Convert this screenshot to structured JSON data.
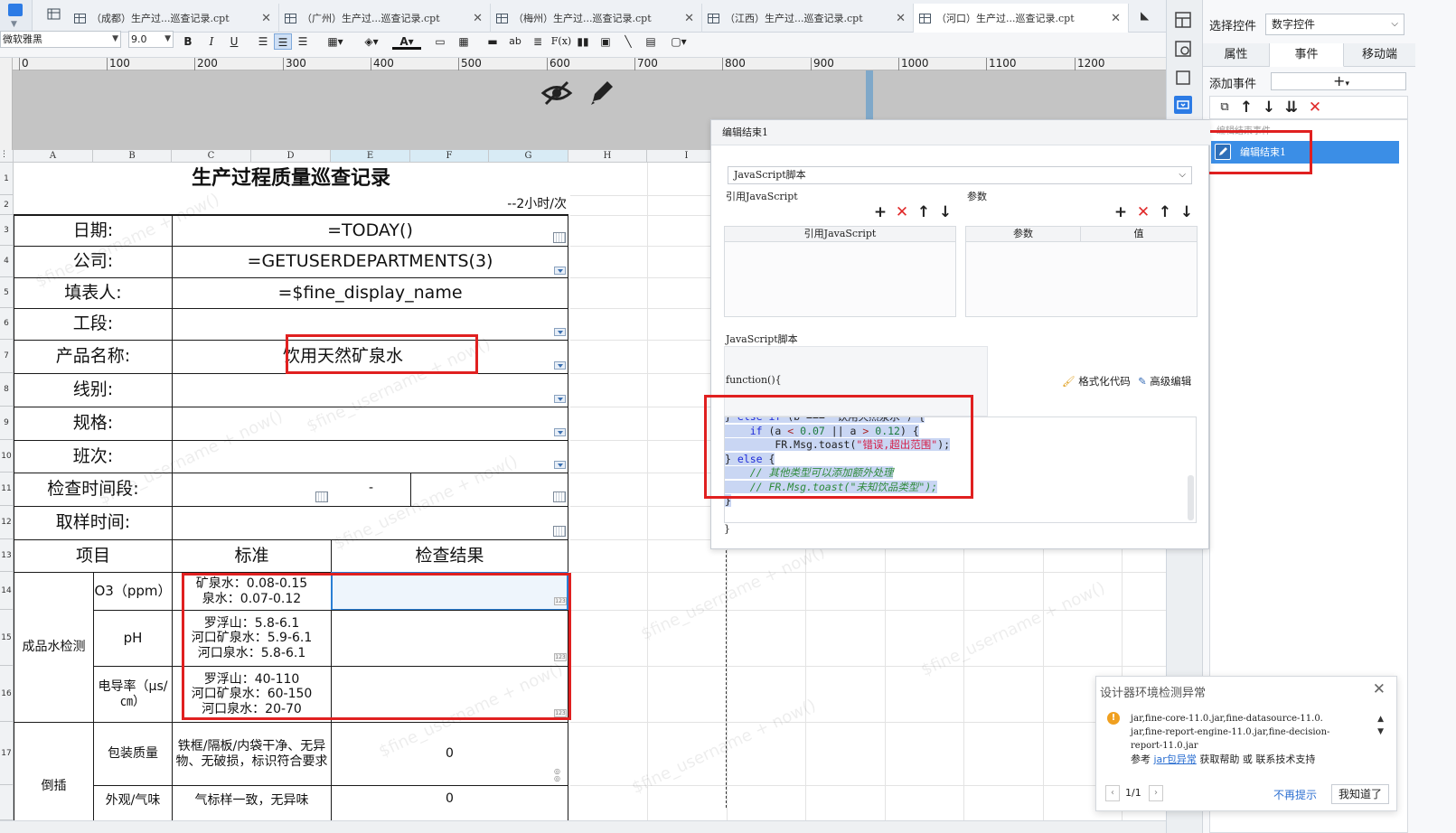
{
  "tabs": [
    {
      "label": "（成都）生产过...巡查记录.cpt",
      "active": false
    },
    {
      "label": "（广州）生产过...巡查记录.cpt",
      "active": false
    },
    {
      "label": "（梅州）生产过...巡查记录.cpt",
      "active": false
    },
    {
      "label": "（江西）生产过...巡查记录.cpt",
      "active": false
    },
    {
      "label": "（河口）生产过...巡查记录.cpt",
      "active": true
    }
  ],
  "toolbar": {
    "font_name": "微软雅黑",
    "font_size": "9.0",
    "bold": "B",
    "italic": "I",
    "underline": "U",
    "text_style_a": "A",
    "ab_label": "ab",
    "fx_label": "F(x)"
  },
  "ruler": {
    "marks": [
      "0",
      "100",
      "200",
      "300",
      "400",
      "500",
      "600",
      "700",
      "800",
      "900",
      "1000",
      "1100",
      "1200"
    ]
  },
  "columns": [
    "A",
    "B",
    "C",
    "D",
    "E",
    "F",
    "G",
    "H",
    "I"
  ],
  "rows": [
    "1",
    "2",
    "3",
    "4",
    "5",
    "6",
    "7",
    "8",
    "9",
    "10",
    "11",
    "12",
    "13",
    "14",
    "15",
    "16",
    "17"
  ],
  "report": {
    "title": "生产过程质量巡查记录",
    "frequency": "--2小时/次",
    "date_label": "日期:",
    "date_value": "=TODAY()",
    "company_label": "公司:",
    "company_value": "=GETUSERDEPARTMENTS(3)",
    "filler_label": "填表人:",
    "filler_value": "=$fine_display_name",
    "section_label": "工段:",
    "product_label": "产品名称:",
    "product_value": "饮用天然矿泉水",
    "line_label": "线别:",
    "spec_label": "规格:",
    "shift_label": "班次:",
    "period_label": "检查时间段:",
    "period_sep": "-",
    "sample_label": "取样时间:",
    "col_item": "项目",
    "col_standard": "标准",
    "col_result": "检查结果",
    "group1": "成品水检测",
    "o3_label": "O3（ppm）",
    "o3_std": [
      "矿泉水：0.08-0.15",
      "泉水：0.07-0.12"
    ],
    "ph_label": "pH",
    "ph_std": [
      "罗浮山：5.8-6.1",
      "河口矿泉水：5.9-6.1",
      "河口泉水：5.8-6.1"
    ],
    "cond_label": "电导率（μs/㎝）",
    "cond_std": [
      "罗浮山：40-110",
      "河口矿泉水：60-150",
      "河口泉水：20-70"
    ],
    "pack_label": "包装质量",
    "pack_std": "铁框/隔板/内袋干净、无异物、无破损，标识符合要求",
    "pack_result": "0",
    "group2": "倒插",
    "appear_label": "外观/气味",
    "appear_std": "气标样一致，无异味",
    "appear_result": "0"
  },
  "watermark": "$fine_username + now()",
  "propanel": {
    "select_label": "选择控件",
    "select_value": "数字控件",
    "tabs": [
      "属性",
      "事件",
      "移动端"
    ],
    "add_event_label": "添加事件",
    "add_symbol": "+",
    "event_group": "编辑结束事件",
    "event_item": "编辑结束1"
  },
  "dialog": {
    "title": "编辑结束1",
    "type_value": "JavaScript脚本",
    "ref_js_label": "引用JavaScript",
    "params_label": "参数",
    "ref_js_header": "引用JavaScript",
    "param_header": "参数",
    "value_header": "值",
    "script_label": "JavaScript脚本",
    "function_open": "function(){",
    "format_code": "格式化代码",
    "advanced_edit": "高级编辑",
    "function_close": "}"
  },
  "warning": {
    "title": "设计器环境检测异常",
    "message_line1": "jar,fine-core-11.0.jar,fine-datasource-11.0.",
    "message_line2": "jar,fine-report-engine-11.0.jar,fine-decision-",
    "message_line3": "report-11.0.jar",
    "help_prefix": "参考",
    "help_link": "jar包异常",
    "help_suffix": "获取帮助 或 联系技术支持",
    "page": "1/1",
    "no_remind": "不再提示",
    "ok": "我知道了"
  },
  "colors": {
    "accent": "#2c7be5",
    "highlight_red": "#e02020",
    "selected_event": "#3b8ee6"
  }
}
